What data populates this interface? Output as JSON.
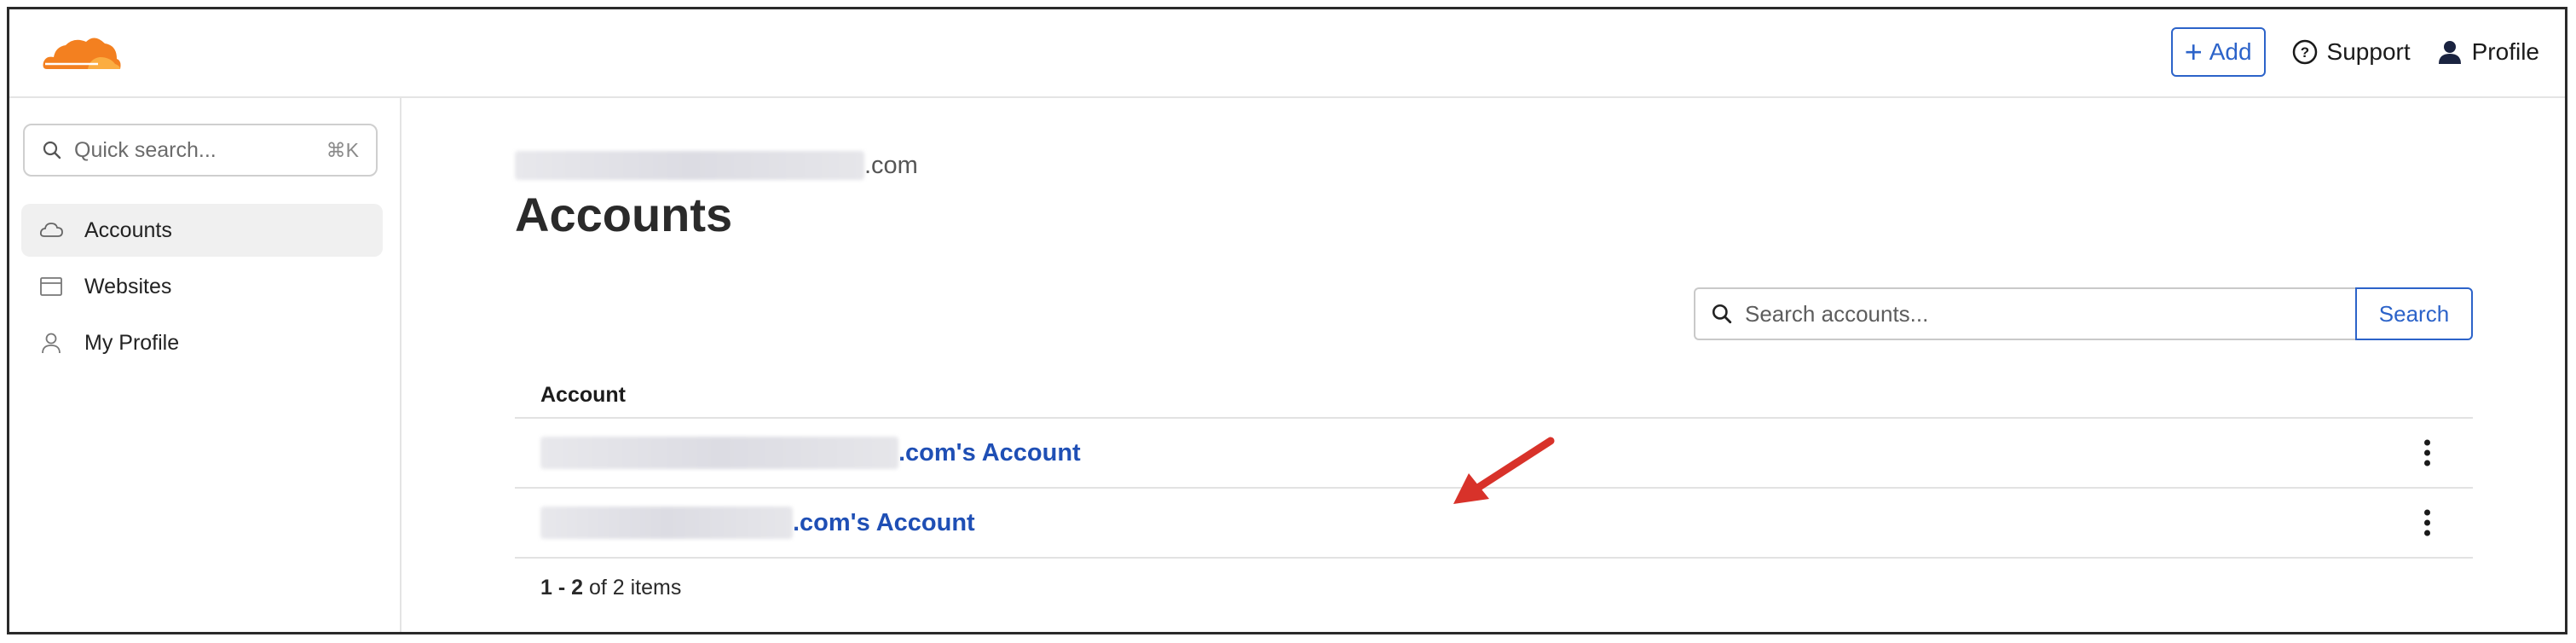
{
  "header": {
    "add_label": "Add",
    "support_label": "Support",
    "profile_label": "Profile",
    "brand_color": "#f38020",
    "accent_color": "#2c63c9"
  },
  "sidebar": {
    "search_placeholder": "Quick search...",
    "search_shortcut": "⌘K",
    "items": [
      {
        "label": "Accounts",
        "icon": "cloud-icon",
        "active": true
      },
      {
        "label": "Websites",
        "icon": "browser-window-icon",
        "active": false
      },
      {
        "label": "My Profile",
        "icon": "person-icon",
        "active": false
      }
    ]
  },
  "main": {
    "email_suffix": ".com",
    "title": "Accounts",
    "search_placeholder": "Search accounts...",
    "search_button": "Search",
    "table": {
      "column_header": "Account",
      "rows": [
        {
          "name_suffix": ".com's Account"
        },
        {
          "name_suffix": ".com's Account"
        }
      ]
    },
    "pager": {
      "range": "1 - 2",
      "total": "of 2 items"
    }
  }
}
